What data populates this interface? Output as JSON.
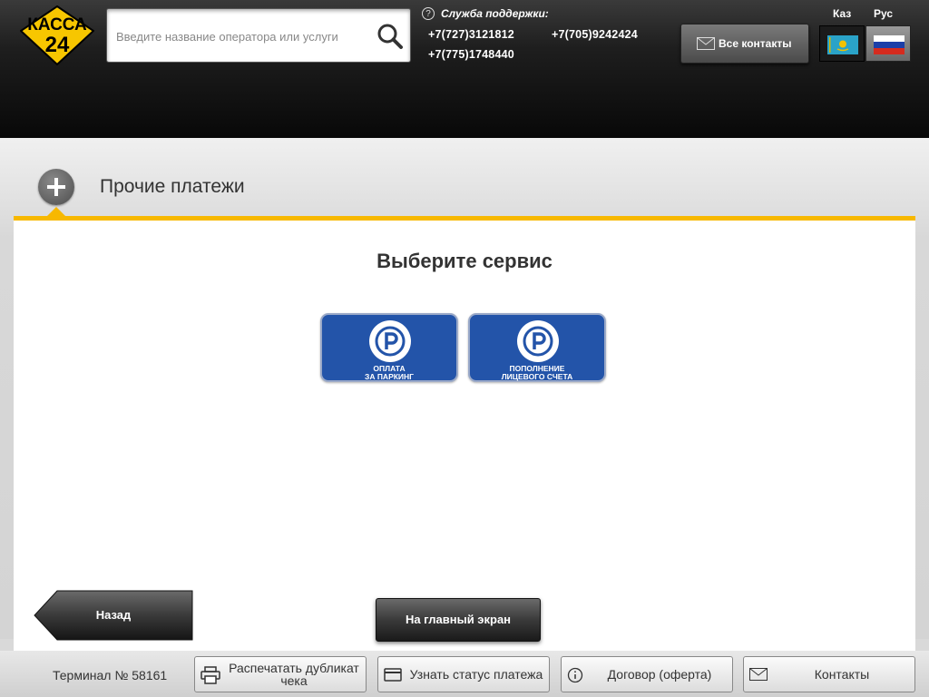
{
  "header": {
    "logo_text_top": "КАССА",
    "logo_text_bottom": "24",
    "search_placeholder": "Введите название оператора или услуги",
    "support_title": "Служба поддержки:",
    "support_icon": "?",
    "phones": [
      "+7(727)3121812",
      "+7(705)9242424",
      "+7(775)1748440"
    ],
    "contacts_label": "Все контакты",
    "languages": [
      {
        "label": "Каз",
        "flag": "kz-flag-icon",
        "selected": false
      },
      {
        "label": "Рус",
        "flag": "ru-flag-icon",
        "selected": true
      }
    ]
  },
  "category": {
    "title": "Прочие платежи",
    "icon": "plus-icon"
  },
  "main": {
    "heading": "Выберите сервис",
    "services": [
      {
        "label_line1": "Оплата",
        "label_line2": "за паркинг",
        "icon": "parking-icon"
      },
      {
        "label_line1": "Пополнение",
        "label_line2": "лицевого счета",
        "icon": "parking-icon"
      }
    ],
    "back_label": "Назад",
    "home_label": "На главный экран"
  },
  "footer": {
    "terminal": "Терминал № 58161",
    "buttons": [
      {
        "label": "Распечатать дубликат чека",
        "icon": "printer-icon"
      },
      {
        "label": "Узнать статус платежа",
        "icon": "card-icon"
      },
      {
        "label": "Договор (оферта)",
        "icon": "info-icon"
      },
      {
        "label": "Контакты",
        "icon": "envelope-icon"
      }
    ]
  },
  "colors": {
    "accent": "#f7b800",
    "service_tile": "#2354a9",
    "header_dark": "#080808"
  }
}
